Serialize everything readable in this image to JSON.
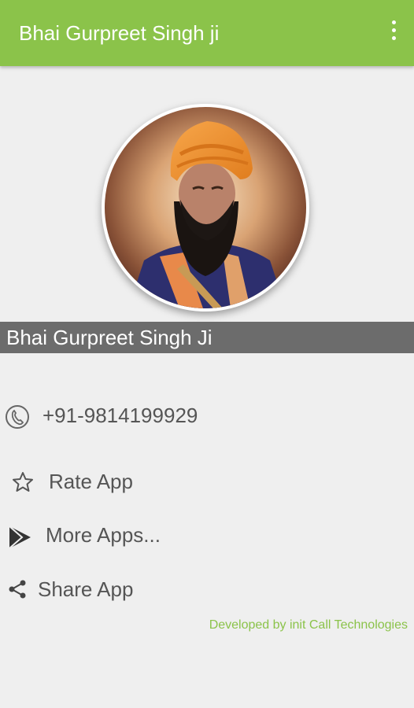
{
  "appbar": {
    "title": "Bhai Gurpreet Singh ji",
    "background": "#8bc34a",
    "overflow_icon": "more-vert-icon"
  },
  "profile": {
    "name": "Bhai Gurpreet Singh Ji"
  },
  "actions": [
    {
      "icon": "phone-icon",
      "label": "+91-9814199929"
    },
    {
      "icon": "star-outline-icon",
      "label": "Rate App"
    },
    {
      "icon": "play-store-icon",
      "label": "More Apps..."
    },
    {
      "icon": "share-icon",
      "label": "Share App"
    }
  ],
  "footer": {
    "text": "Developed by init Call Technologies",
    "color": "#8bc34a"
  }
}
